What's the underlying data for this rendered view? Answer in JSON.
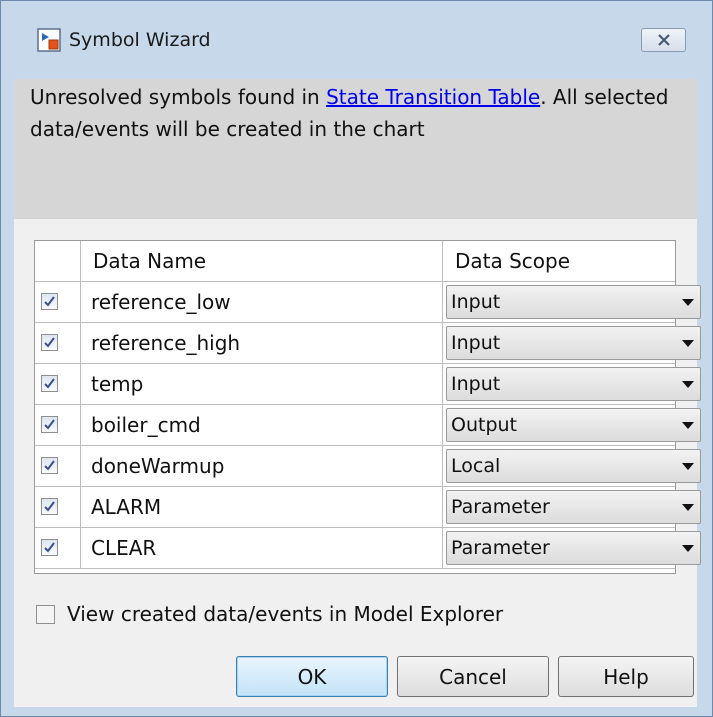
{
  "window": {
    "title": "Symbol Wizard",
    "close_icon": "close-icon"
  },
  "message": {
    "prefix": "Unresolved symbols found in ",
    "link": "State Transition Table",
    "suffix": ". All selected data/events will be created in the chart"
  },
  "table": {
    "headers": {
      "name": "Data Name",
      "scope": "Data Scope"
    },
    "rows": [
      {
        "checked": true,
        "name": "reference_low",
        "scope": "Input"
      },
      {
        "checked": true,
        "name": "reference_high",
        "scope": "Input"
      },
      {
        "checked": true,
        "name": "temp",
        "scope": "Input"
      },
      {
        "checked": true,
        "name": "boiler_cmd",
        "scope": "Output"
      },
      {
        "checked": true,
        "name": "doneWarmup",
        "scope": "Local"
      },
      {
        "checked": true,
        "name": "ALARM",
        "scope": "Parameter"
      },
      {
        "checked": true,
        "name": "CLEAR",
        "scope": "Parameter"
      }
    ]
  },
  "options": {
    "view_in_explorer_label": "View created data/events in Model Explorer",
    "view_in_explorer_checked": false
  },
  "buttons": {
    "ok": "OK",
    "cancel": "Cancel",
    "help": "Help"
  },
  "colors": {
    "link": "#0000ee",
    "window_frame": "#c6d8ea",
    "client": "#f0f0f0",
    "message_panel": "#d6d6d6"
  }
}
